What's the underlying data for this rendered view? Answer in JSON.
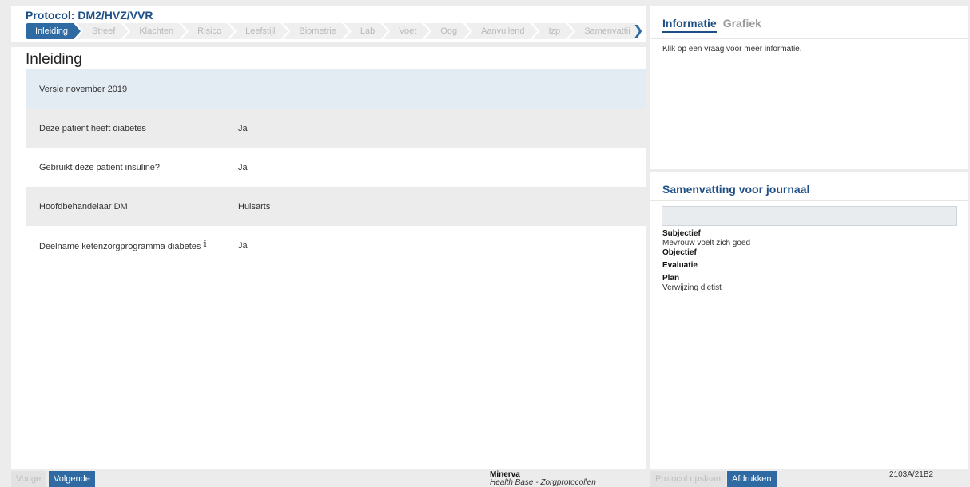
{
  "protocol_title": "Protocol: DM2/HVZ/VVR",
  "steps": [
    "Inleiding",
    "Streef",
    "Klachten",
    "Risico",
    "Leefstijl",
    "Biometrie",
    "Lab",
    "Voet",
    "Oog",
    "Aanvullend",
    "Izp",
    "Samenvattii"
  ],
  "active_step": "Inleiding",
  "steps_next_icon": "chevron-right-icon",
  "main": {
    "title": "Inleiding",
    "version_row": "Versie november 2019",
    "rows": [
      {
        "question": "Deze patient heeft diabetes",
        "answer": "Ja"
      },
      {
        "question": "Gebruikt deze patient insuline?",
        "answer": "Ja"
      },
      {
        "question": "Hoofdbehandelaar DM",
        "answer": "Huisarts"
      },
      {
        "question": "Deelname ketenzorgprogramma diabetes",
        "info_icon": "i",
        "answer": "Ja"
      }
    ]
  },
  "info_panel": {
    "tab_active": "Informatie",
    "tab_inactive": "Grafiek",
    "text": "Klik op een vraag voor meer informatie."
  },
  "summary": {
    "title": "Samenvatting voor journaal",
    "input_value": "",
    "subjectief_label": "Subjectief",
    "subjectief_text": "Mevrouw voelt zich goed",
    "objectief_label": "Objectief",
    "evaluatie_label": "Evaluatie",
    "plan_label": "Plan",
    "plan_text": "Verwijzing dietist"
  },
  "footer": {
    "prev_label": "Vorige",
    "next_label": "Volgende",
    "app_name": "Minerva",
    "app_sub": "Health Base - Zorgprotocollen",
    "save_label": "Protocol opslaan",
    "print_label": "Afdrukken",
    "version": "2103A/21B2"
  },
  "colors": {
    "accent": "#2f6aa3",
    "title": "#1e4f86",
    "row_highlight": "#e3ebf3",
    "row_grey": "#ececec"
  }
}
